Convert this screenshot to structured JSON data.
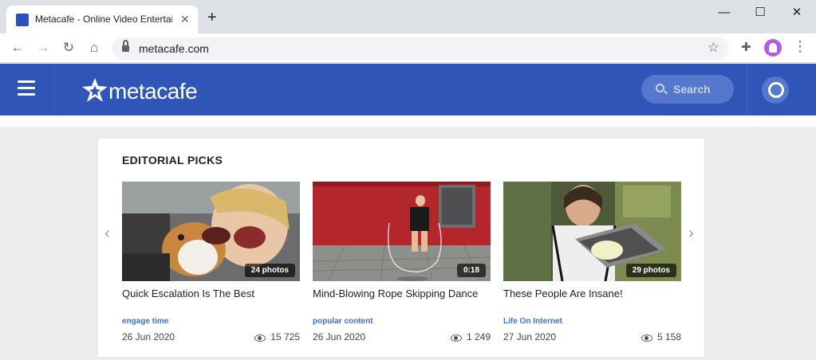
{
  "browser": {
    "tab_title": "Metacafe - Online Video Entertainment",
    "url": "metacafe.com"
  },
  "header": {
    "logo_text": "metacafe",
    "search_label": "Search"
  },
  "editorial": {
    "title": "EDITORIAL PICKS",
    "items": [
      {
        "title": "Quick Escalation Is The Best",
        "badge": "24 photos",
        "tag": "engage time",
        "date": "26 Jun 2020",
        "views": "15 725"
      },
      {
        "title": "Mind-Blowing Rope Skipping Dance",
        "badge": "0:18",
        "tag": "popular content",
        "date": "26 Jun 2020",
        "views": "1 249"
      },
      {
        "title": "These People Are Insane!",
        "badge": "29 photos",
        "tag": "Life On Internet",
        "date": "27 Jun 2020",
        "views": "5 158"
      }
    ]
  },
  "colors": {
    "header_blue": "#2f55b8",
    "tag_blue": "#3d6fd1"
  }
}
